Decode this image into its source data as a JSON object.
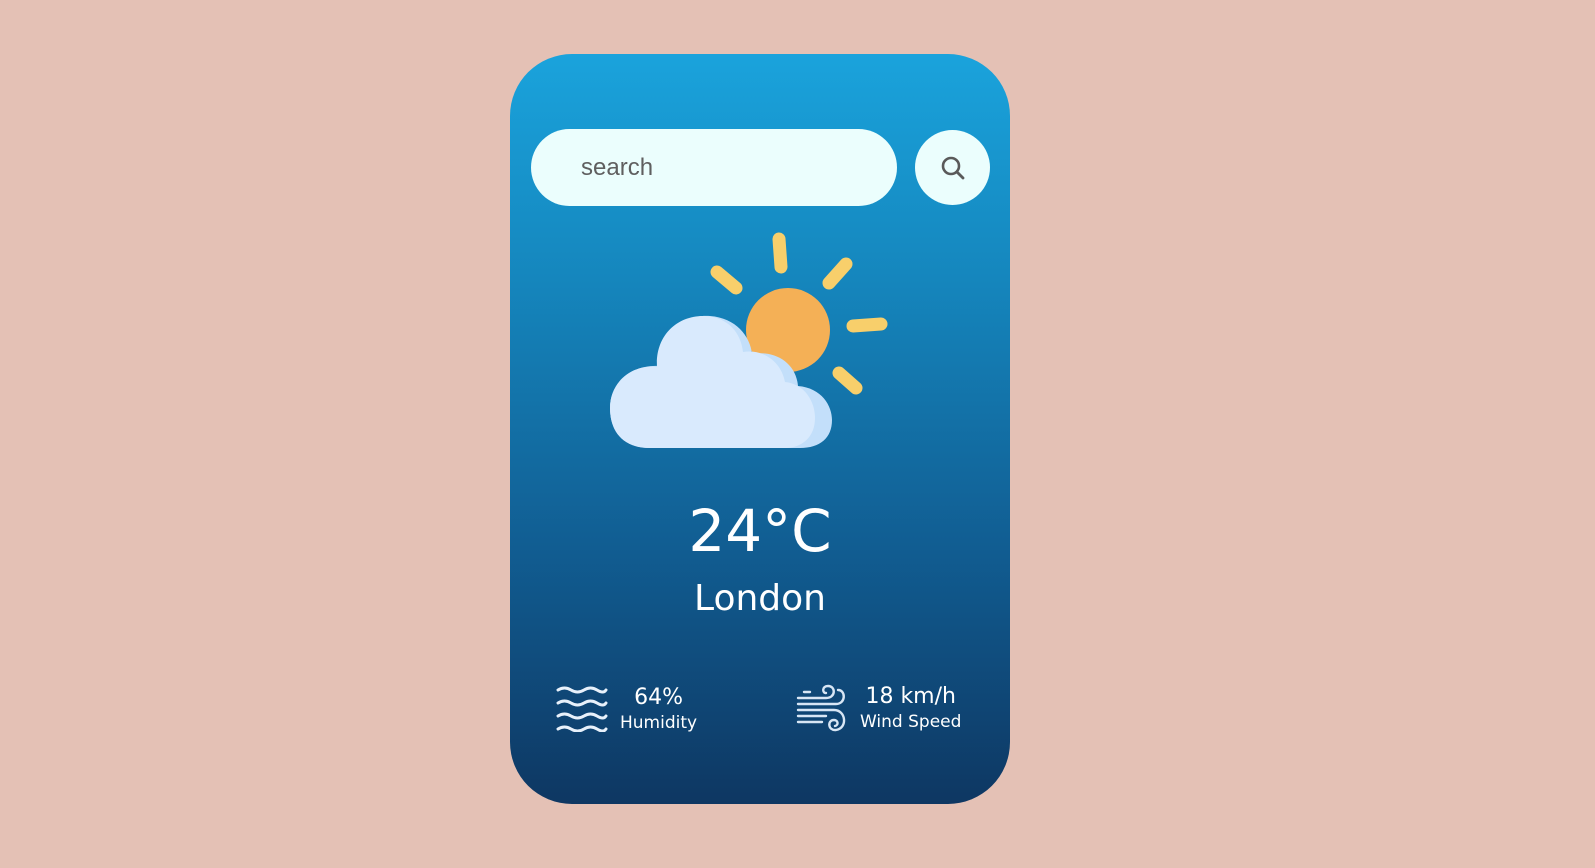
{
  "search": {
    "placeholder": "search",
    "button_icon": "search-icon"
  },
  "weather": {
    "icon": "partly-cloudy-icon",
    "temperature": "24°C",
    "city": "London"
  },
  "stats": {
    "humidity": {
      "value": "64%",
      "label": "Humidity",
      "icon": "humidity-waves-icon"
    },
    "wind": {
      "value": "18 km/h",
      "label": "Wind Speed",
      "icon": "wind-icon"
    }
  },
  "colors": {
    "page_background": "#e4c1b5",
    "card_gradient_top": "#1aa3dc",
    "card_gradient_bottom": "#0e3762",
    "input_background": "#ebfefd",
    "sun": "#f4b056",
    "sun_rays": "#f8cf6b",
    "cloud": "#d9eafd",
    "cloud_shadow": "#c3dffa"
  }
}
